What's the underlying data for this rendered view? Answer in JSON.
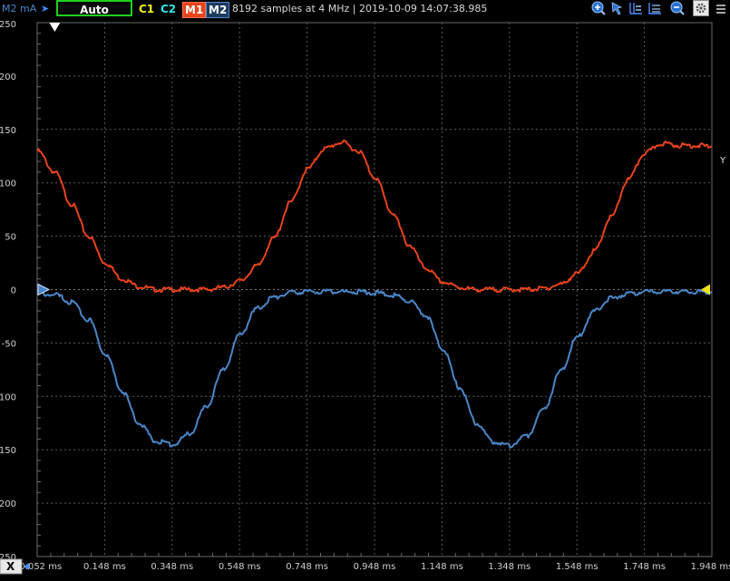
{
  "toolbar": {
    "unit_label": "M2 mA",
    "trigger_mode": "Auto",
    "channels": [
      {
        "label": "C1",
        "color": "#f2f21a"
      },
      {
        "label": "C2",
        "color": "#2ee6e6"
      },
      {
        "label": "M1",
        "color": "#e8431a"
      },
      {
        "label": "M2",
        "color": "#4a86c8"
      }
    ],
    "info": "8192 samples at 4 MHz | 2019-10-09 14:07:38.985",
    "icons": [
      "zoom-in-icon",
      "cursor-icon",
      "cursor-grid-icon",
      "measure-icon",
      "zoom-out-icon",
      "settings-icon"
    ]
  },
  "right_axis_letter": "Y",
  "x_axis_letter": "X",
  "chart_data": {
    "type": "line",
    "title": "",
    "xlabel": "",
    "ylabel": "M2 mA",
    "ylim": [
      -250,
      250
    ],
    "xlim": [
      -0.052,
      1.948
    ],
    "y_ticks": [
      250,
      200,
      150,
      100,
      50,
      0,
      -50,
      -100,
      -150,
      -200,
      -250
    ],
    "y_tick_labels": [
      "250",
      "200",
      "150",
      "100",
      "50",
      "0",
      "-50",
      "-100",
      "-150",
      "-200",
      "-250"
    ],
    "x_tick_labels": [
      "-0.052 ms",
      "0.148 ms",
      "0.348 ms",
      "0.548 ms",
      "0.748 ms",
      "0.948 ms",
      "1.148 ms",
      "1.348 ms",
      "1.548 ms",
      "1.748 ms",
      "1.948 ms"
    ],
    "x_ticks": [
      -0.052,
      0.148,
      0.348,
      0.548,
      0.748,
      0.948,
      1.148,
      1.348,
      1.548,
      1.748,
      1.948
    ],
    "grid": true,
    "series": [
      {
        "name": "M1",
        "color": "#e8431a",
        "x": [
          -0.052,
          0.0,
          0.05,
          0.1,
          0.15,
          0.2,
          0.25,
          0.3,
          0.35,
          0.4,
          0.45,
          0.5,
          0.55,
          0.6,
          0.65,
          0.7,
          0.75,
          0.8,
          0.85,
          0.9,
          0.95,
          1.0,
          1.05,
          1.1,
          1.15,
          1.2,
          1.25,
          1.3,
          1.35,
          1.4,
          1.45,
          1.5,
          1.55,
          1.6,
          1.65,
          1.7,
          1.75,
          1.8,
          1.85,
          1.9,
          1.948
        ],
        "values": [
          130,
          110,
          80,
          50,
          25,
          10,
          3,
          0,
          0,
          0,
          0,
          2,
          8,
          22,
          48,
          82,
          113,
          132,
          138,
          130,
          105,
          72,
          42,
          20,
          7,
          2,
          0,
          0,
          0,
          0,
          1,
          5,
          15,
          36,
          68,
          103,
          128,
          137,
          135,
          135,
          134
        ]
      },
      {
        "name": "M2",
        "color": "#4a86c8",
        "x": [
          -0.052,
          0.0,
          0.05,
          0.1,
          0.15,
          0.2,
          0.25,
          0.3,
          0.35,
          0.4,
          0.45,
          0.5,
          0.55,
          0.6,
          0.65,
          0.7,
          0.75,
          0.8,
          0.85,
          0.9,
          0.95,
          1.0,
          1.05,
          1.1,
          1.15,
          1.2,
          1.25,
          1.3,
          1.35,
          1.4,
          1.45,
          1.5,
          1.55,
          1.6,
          1.65,
          1.7,
          1.75,
          1.8,
          1.85,
          1.9,
          1.948
        ],
        "values": [
          -3,
          -5,
          -12,
          -28,
          -60,
          -95,
          -125,
          -142,
          -145,
          -135,
          -110,
          -75,
          -42,
          -18,
          -7,
          -3,
          -2,
          -2,
          -2,
          -2,
          -3,
          -5,
          -10,
          -24,
          -55,
          -92,
          -125,
          -143,
          -146,
          -137,
          -112,
          -77,
          -44,
          -20,
          -8,
          -4,
          -2,
          -2,
          -2,
          -2,
          -2
        ]
      }
    ]
  }
}
